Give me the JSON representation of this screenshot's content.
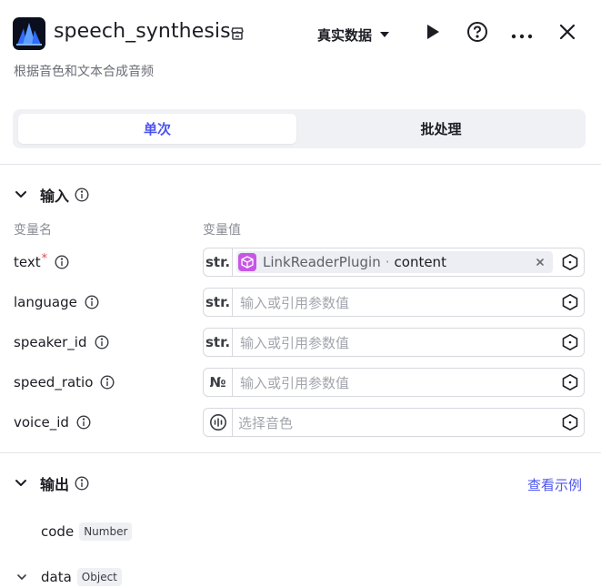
{
  "header": {
    "title": "speech_synthesis",
    "description": "根据音色和文本合成音频",
    "mode_label": "真实数据",
    "icons": {
      "logo": "app-logo-icon",
      "badge": "store-icon",
      "dropdown": "caret-down-icon",
      "run": "play-icon",
      "help": "help-circle-icon",
      "more": "more-horizontal-icon",
      "close": "close-icon"
    }
  },
  "tabs": [
    {
      "label": "单次",
      "active": true
    },
    {
      "label": "批处理",
      "active": false
    }
  ],
  "input_section": {
    "title": "输入",
    "col_name": "变量名",
    "col_value": "变量值",
    "rows": [
      {
        "name": "text",
        "required": true,
        "required_mark": "*",
        "prefix": "str.",
        "ref_source": "LinkReaderPlugin",
        "ref_sep": "·",
        "ref_field": "content"
      },
      {
        "name": "language",
        "required": false,
        "prefix": "str.",
        "placeholder": "输入或引用参数值"
      },
      {
        "name": "speaker_id",
        "required": false,
        "prefix": "str.",
        "placeholder": "输入或引用参数值"
      },
      {
        "name": "speed_ratio",
        "required": false,
        "prefix": "№",
        "placeholder": "输入或引用参数值"
      },
      {
        "name": "voice_id",
        "required": false,
        "prefix_icon": "voice-icon",
        "placeholder": "选择音色"
      }
    ]
  },
  "output_section": {
    "title": "输出",
    "link": "查看示例",
    "items": [
      {
        "name": "code",
        "type": "Number",
        "expandable": false
      },
      {
        "name": "data",
        "type": "Object",
        "expandable": true
      }
    ]
  },
  "colors": {
    "accent": "#4c54f0",
    "required": "#e5484d",
    "plugin_chip": "#c756e5"
  }
}
